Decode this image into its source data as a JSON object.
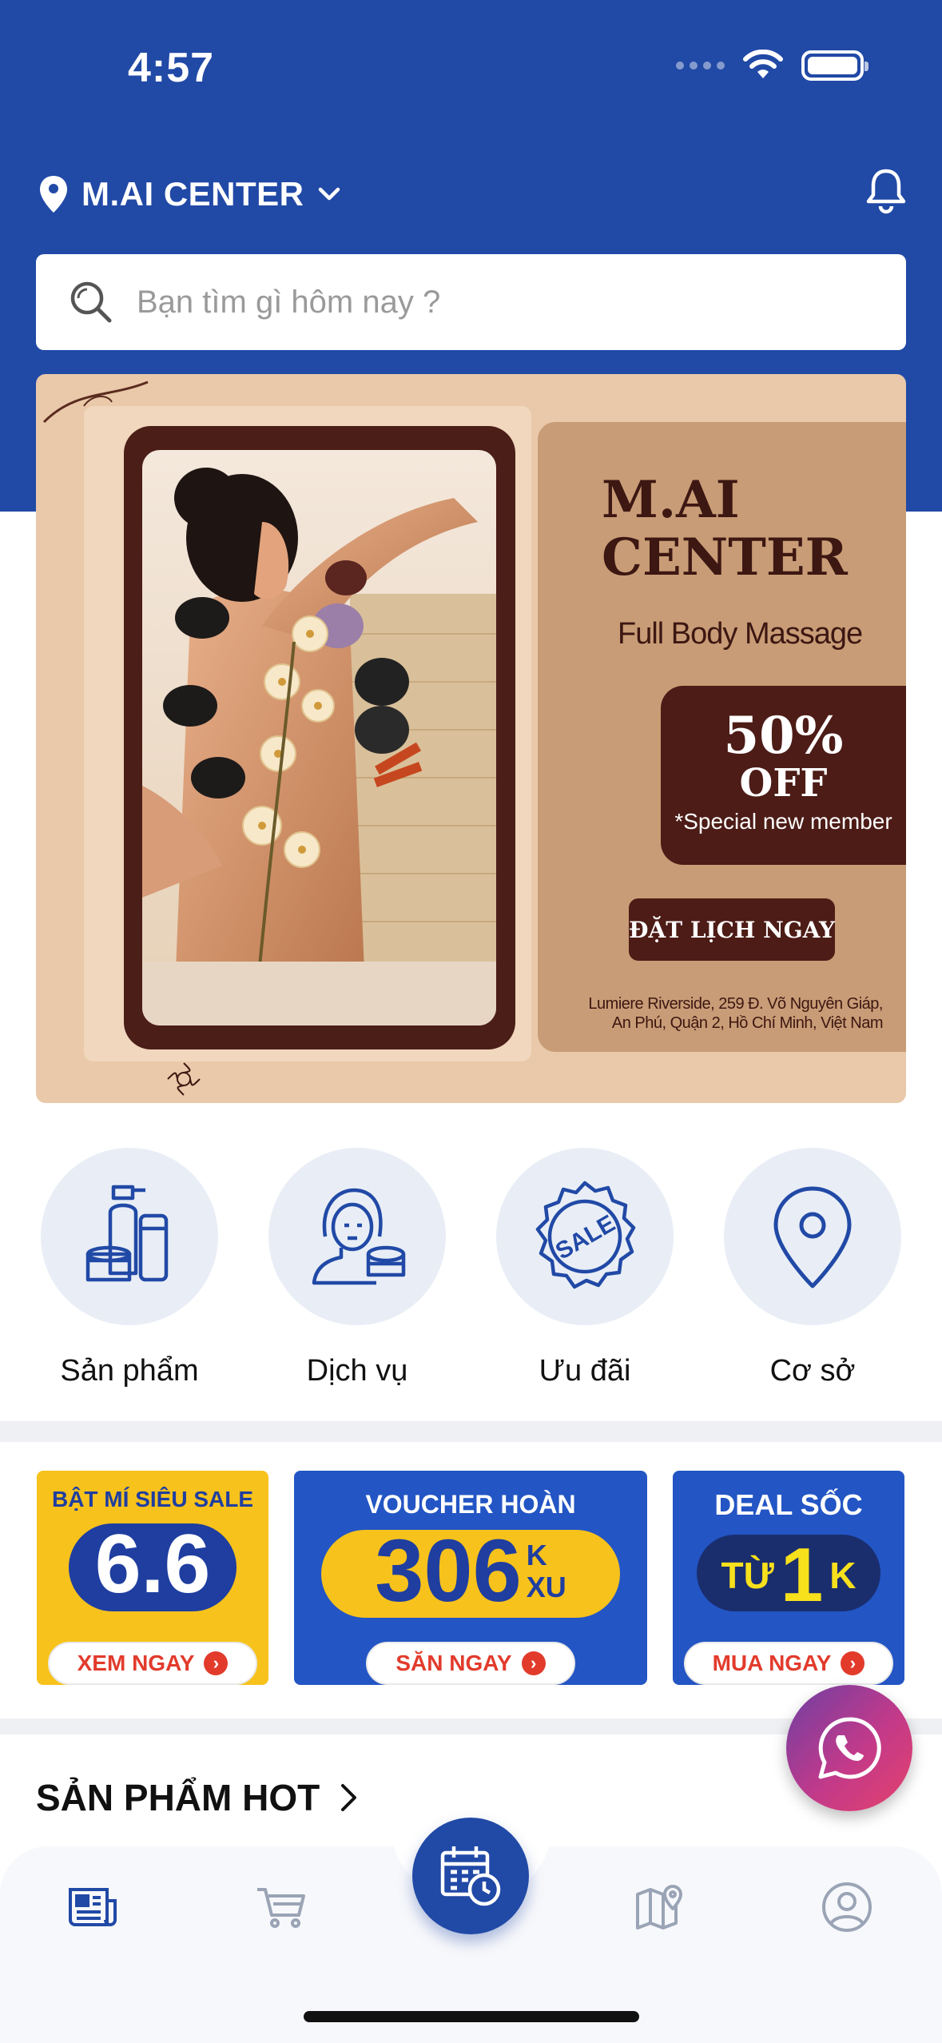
{
  "status_bar": {
    "time": "4:57"
  },
  "header": {
    "location_label": "M.AI CENTER"
  },
  "search": {
    "placeholder": "Bạn tìm gì hôm nay ?"
  },
  "banner": {
    "brand_line1": "M.AI",
    "brand_line2": "CENTER",
    "subtitle": "Full Body Massage",
    "discount": "50%",
    "off": "OFF",
    "note": "*Special new member",
    "cta": "ĐẶT LỊCH NGAY",
    "address_line1": "Lumiere Riverside, 259 Đ. Võ Nguyên Giáp,",
    "address_line2": "An Phú, Quận 2, Hồ Chí Minh, Việt Nam"
  },
  "categories": [
    {
      "label": "Sản phẩm",
      "icon": "cosmetics-icon"
    },
    {
      "label": "Dịch vụ",
      "icon": "beauty-service-icon"
    },
    {
      "label": "Ưu đãi",
      "icon": "sale-badge-icon"
    },
    {
      "label": "Cơ sở",
      "icon": "location-pin-icon"
    }
  ],
  "vouchers": [
    {
      "title": "BẬT MÍ SIÊU SALE",
      "big": "6.6",
      "button": "XEM NGAY",
      "bg": "#f7c21c"
    },
    {
      "title": "VOUCHER HOÀN",
      "big": "306",
      "unit_top": "K",
      "unit_bottom": "XU",
      "button": "SĂN NGAY",
      "bg": "#2355c4"
    },
    {
      "title": "DEAL SỐC",
      "big_prefix": "TỪ",
      "big": "1",
      "unit_top": "K",
      "button": "MUA NGAY",
      "bg": "#2355c4"
    }
  ],
  "section": {
    "title": "SẢN PHẨM HOT"
  },
  "colors": {
    "primary": "#2149a6",
    "banner_brown": "#4d1c17",
    "accent_red": "#e23b2c"
  },
  "bottom_nav": [
    "news-icon",
    "cart-icon",
    "booking-calendar-icon",
    "map-icon",
    "profile-icon"
  ]
}
